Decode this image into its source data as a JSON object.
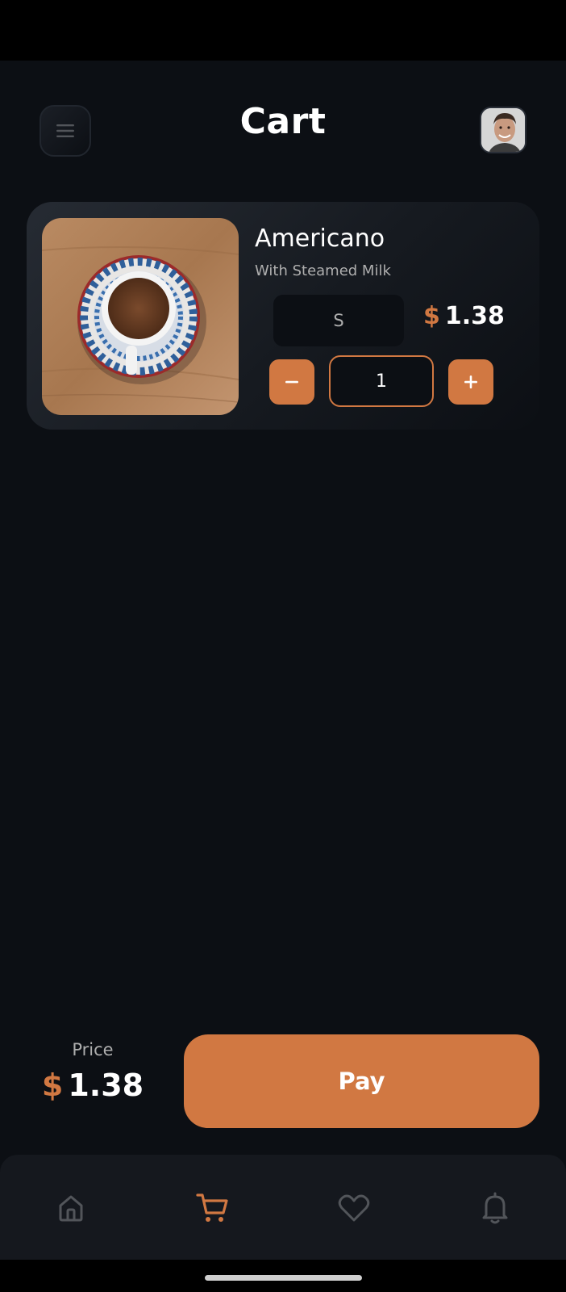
{
  "header": {
    "title": "Cart",
    "menu_icon": "hamburger-icon",
    "avatar": "user-avatar"
  },
  "cart": {
    "items": [
      {
        "name": "Americano",
        "description": "With Steamed Milk",
        "image": "coffee-cup-on-saucer",
        "size": "S",
        "currency": "$",
        "price": "1.38",
        "quantity": "1",
        "minus_label": "−",
        "plus_label": "+"
      }
    ]
  },
  "footer": {
    "price_label": "Price",
    "currency": "$",
    "total": "1.38",
    "pay_label": "Pay"
  },
  "nav": {
    "items": [
      {
        "icon": "home-icon",
        "active": false
      },
      {
        "icon": "cart-icon",
        "active": true
      },
      {
        "icon": "heart-icon",
        "active": false
      },
      {
        "icon": "bell-icon",
        "active": false
      }
    ]
  },
  "colors": {
    "accent": "#D17842",
    "background": "#0C0F14",
    "card": "#262B33",
    "muted_text": "#AEAEAE",
    "inactive_icon": "#52555A"
  }
}
